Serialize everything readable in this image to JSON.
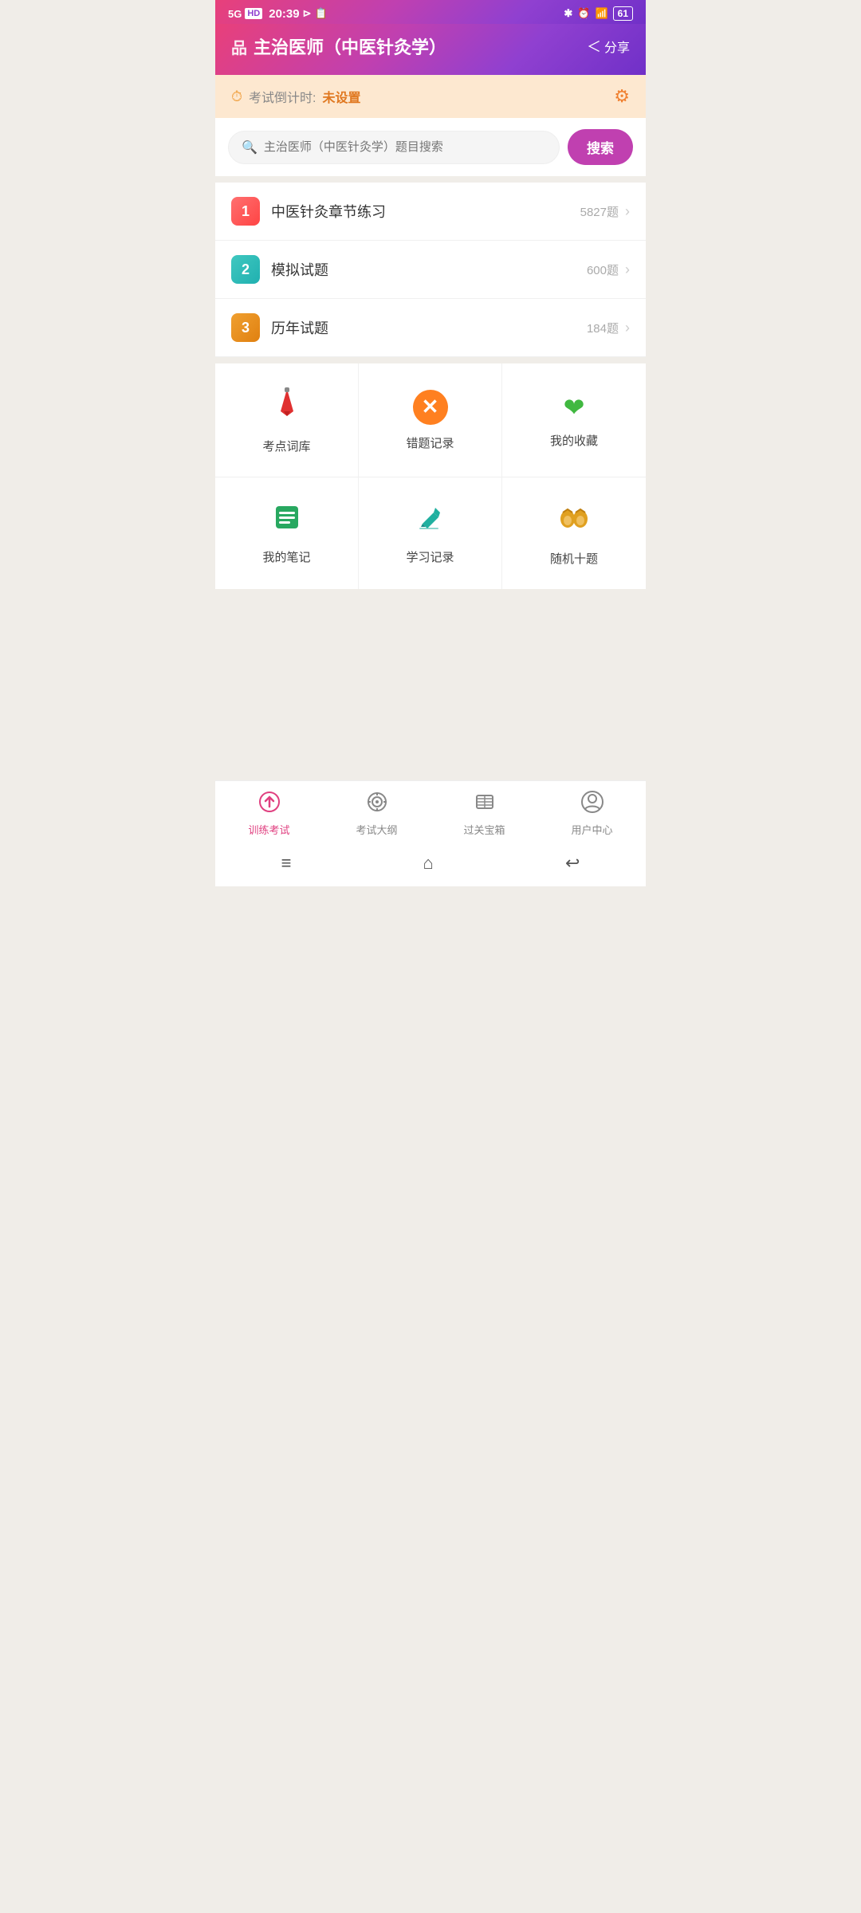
{
  "statusBar": {
    "signal": "5G",
    "hd": "HD",
    "time": "20:39",
    "bluetooth": "⁎",
    "wifi": "WiFi",
    "battery": "61"
  },
  "header": {
    "icon": "品",
    "title": "主治医师（中医针灸学）",
    "shareLabel": "分享"
  },
  "countdown": {
    "label": "考试倒计时:",
    "value": "未设置"
  },
  "search": {
    "placeholder": "主治医师（中医针灸学）题目搜索",
    "buttonLabel": "搜索"
  },
  "categories": [
    {
      "num": "1",
      "name": "中医针灸章节练习",
      "count": "5827题",
      "colorClass": "cat-1"
    },
    {
      "num": "2",
      "name": "模拟试题",
      "count": "600题",
      "colorClass": "cat-2"
    },
    {
      "num": "3",
      "name": "历年试题",
      "count": "184题",
      "colorClass": "cat-3"
    }
  ],
  "tools": [
    {
      "id": "kaodian",
      "label": "考点词库",
      "iconType": "pencil"
    },
    {
      "id": "cuoti",
      "label": "错题记录",
      "iconType": "x-circle"
    },
    {
      "id": "shoucang",
      "label": "我的收藏",
      "iconType": "heart"
    },
    {
      "id": "biji",
      "label": "我的笔记",
      "iconType": "notes"
    },
    {
      "id": "xuexi",
      "label": "学习记录",
      "iconType": "edit2"
    },
    {
      "id": "suiji",
      "label": "随机十题",
      "iconType": "binoculars"
    }
  ],
  "bottomNav": [
    {
      "id": "train",
      "label": "训练考试",
      "active": true,
      "iconType": "home"
    },
    {
      "id": "outline",
      "label": "考试大纲",
      "active": false,
      "iconType": "target"
    },
    {
      "id": "treasure",
      "label": "过关宝箱",
      "active": false,
      "iconType": "book"
    },
    {
      "id": "user",
      "label": "用户中心",
      "active": false,
      "iconType": "user"
    }
  ],
  "systemNav": {
    "menu": "≡",
    "home": "⌂",
    "back": "↩"
  }
}
